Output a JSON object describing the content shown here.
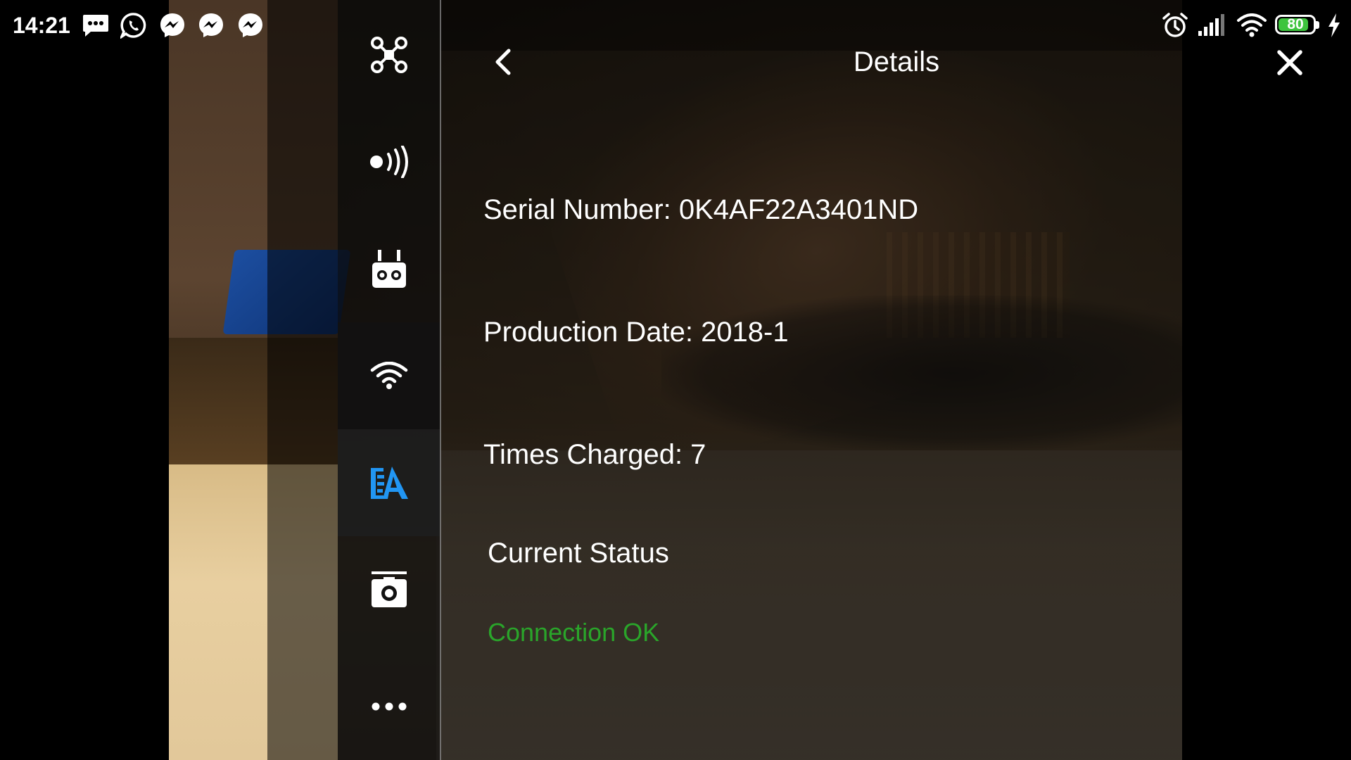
{
  "status_bar": {
    "time": "14:21",
    "battery_level": "80",
    "battery_fraction": 0.8,
    "battery_color": "#3ec43e",
    "notifications": [
      "message-icon",
      "whatsapp-icon",
      "messenger-icon",
      "messenger-icon",
      "messenger-icon"
    ],
    "system_icons": [
      "alarm-icon",
      "cell-signal-icon",
      "wifi-icon",
      "battery-icon",
      "charging-icon"
    ]
  },
  "sidebar": {
    "items": [
      {
        "icon": "aircraft-icon",
        "active": false
      },
      {
        "icon": "signal-strength-icon",
        "active": false
      },
      {
        "icon": "remote-controller-icon",
        "active": false
      },
      {
        "icon": "wifi-icon",
        "active": false
      },
      {
        "icon": "battery-icon",
        "active": true,
        "accent": "#2196f3"
      },
      {
        "icon": "camera-icon",
        "active": false
      },
      {
        "icon": "more-icon",
        "active": false
      }
    ]
  },
  "header": {
    "title": "Details",
    "back_icon": "chevron-left-icon",
    "close_icon": "close-icon"
  },
  "details": {
    "serial_number": "Serial Number: 0K4AF22A3401ND",
    "production_date": "Production Date: 2018-1",
    "times_charged": "Times Charged: 7"
  },
  "current_status": {
    "title": "Current Status",
    "value": "Connection OK",
    "color": "#2aa52a"
  }
}
